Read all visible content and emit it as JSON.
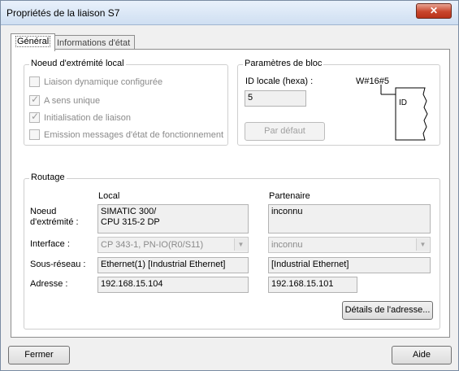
{
  "window": {
    "title": "Propriétés de la liaison S7",
    "close_icon": "close-icon"
  },
  "tabs": [
    {
      "label": "Général",
      "active": true
    },
    {
      "label": "Informations d'état",
      "active": false
    }
  ],
  "noeud_local": {
    "legend": "Noeud d'extrémité local",
    "options": [
      {
        "label": "Liaison dynamique configurée",
        "checked": false
      },
      {
        "label": "A sens unique",
        "checked": true
      },
      {
        "label": "Initialisation de liaison",
        "checked": true
      },
      {
        "label": "Emission messages d'état de fonctionnement",
        "checked": false
      }
    ]
  },
  "parametres_bloc": {
    "legend": "Paramètres de bloc",
    "id_label": "ID locale (hexa) :",
    "id_value": "5",
    "w_value": "W#16#5",
    "block_id_label": "ID",
    "default_button": "Par défaut"
  },
  "routage": {
    "legend": "Routage",
    "col_local": "Local",
    "col_partner": "Partenaire",
    "noeud_label": "Noeud\nd'extrémité :",
    "noeud_local_line1": "SIMATIC 300/",
    "noeud_local_line2": "CPU 315-2 DP",
    "noeud_partner": "inconnu",
    "interface_label": "Interface :",
    "interface_local": "CP 343-1, PN-IO(R0/S11)",
    "interface_partner": "inconnu",
    "sous_reseau_label": "Sous-réseau :",
    "sous_reseau_local": "Ethernet(1) [Industrial Ethernet]",
    "sous_reseau_partner": "[Industrial Ethernet]",
    "adresse_label": "Adresse :",
    "adresse_local": "192.168.15.104",
    "adresse_partner": "192.168.15.101",
    "details_button": "Détails de l'adresse..."
  },
  "footer": {
    "close_button": "Fermer",
    "help_button": "Aide"
  }
}
